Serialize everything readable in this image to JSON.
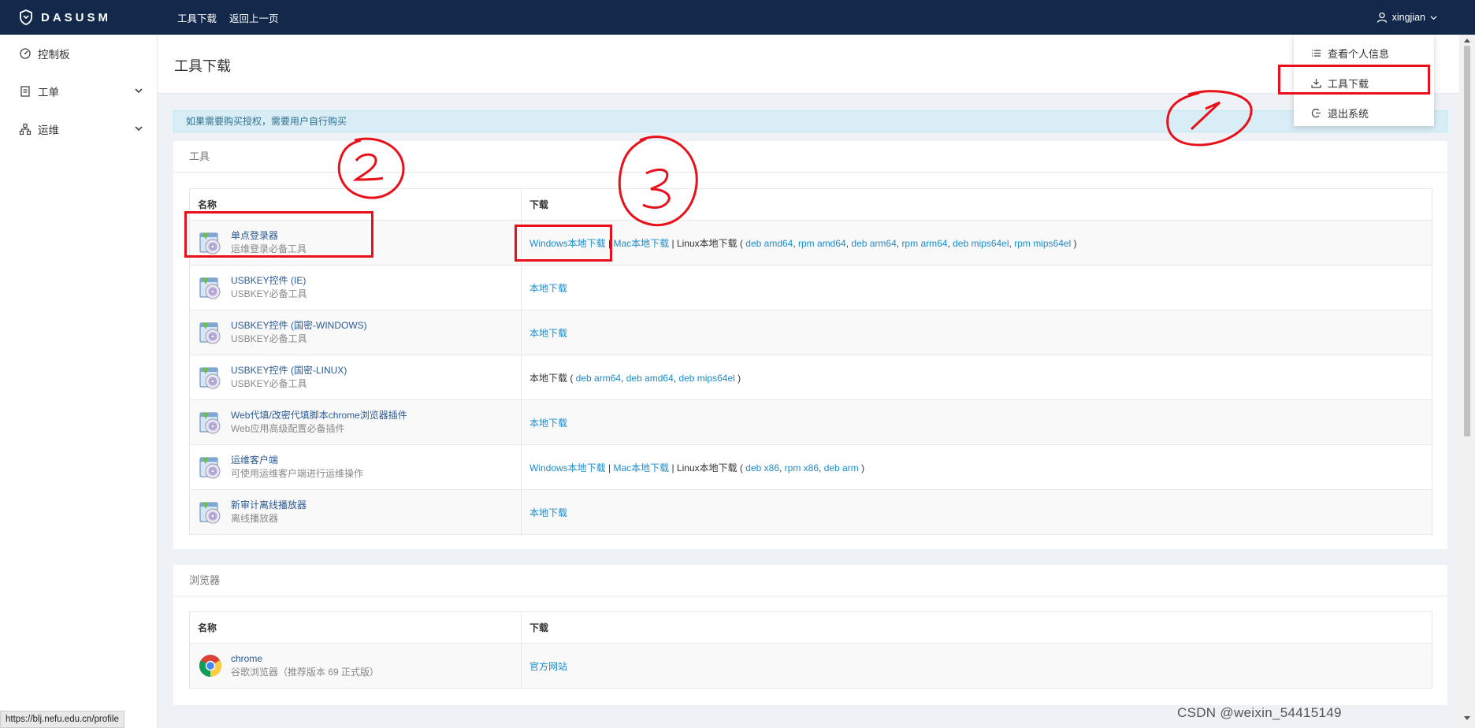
{
  "navbar": {
    "brand": "DASUSM",
    "links": [
      "工具下载",
      "返回上一页"
    ],
    "username": "xingjian"
  },
  "user_menu": {
    "items": [
      {
        "label": "查看个人信息",
        "icon": "list-icon"
      },
      {
        "label": "工具下载",
        "icon": "download-icon"
      },
      {
        "label": "退出系统",
        "icon": "logout-icon"
      }
    ]
  },
  "sidebar": {
    "items": [
      {
        "label": "控制板",
        "icon": "dashboard-icon"
      },
      {
        "label": "工单",
        "icon": "ticket-icon"
      },
      {
        "label": "运维",
        "icon": "sitemap-icon"
      }
    ]
  },
  "page": {
    "title": "工具下载",
    "notice": "如果需要购买授权，需要用户自行购买"
  },
  "tools_panel": {
    "title": "工具",
    "columns": [
      "名称",
      "下载"
    ],
    "rows": [
      {
        "name": "单点登录器",
        "desc": "运维登录必备工具",
        "download": [
          {
            "text": "Windows本地下载",
            "link": true
          },
          {
            "text": " | ",
            "link": false
          },
          {
            "text": "Mac本地下载",
            "link": true
          },
          {
            "text": " | Linux本地下载 ( ",
            "link": false
          },
          {
            "text": "deb amd64",
            "link": true
          },
          {
            "text": ", ",
            "link": false
          },
          {
            "text": "rpm amd64",
            "link": true
          },
          {
            "text": ", ",
            "link": false
          },
          {
            "text": "deb arm64",
            "link": true
          },
          {
            "text": ", ",
            "link": false
          },
          {
            "text": "rpm arm64",
            "link": true
          },
          {
            "text": ", ",
            "link": false
          },
          {
            "text": "deb mips64el",
            "link": true
          },
          {
            "text": ", ",
            "link": false
          },
          {
            "text": "rpm mips64el",
            "link": true
          },
          {
            "text": " )",
            "link": false
          }
        ]
      },
      {
        "name": "USBKEY控件 (IE)",
        "desc": "USBKEY必备工具",
        "download": [
          {
            "text": "本地下载",
            "link": true
          }
        ]
      },
      {
        "name": "USBKEY控件 (国密-WINDOWS)",
        "desc": "USBKEY必备工具",
        "download": [
          {
            "text": "本地下载",
            "link": true
          }
        ]
      },
      {
        "name": "USBKEY控件 (国密-LINUX)",
        "desc": "USBKEY必备工具",
        "download": [
          {
            "text": "本地下载 ( ",
            "link": false
          },
          {
            "text": "deb arm64",
            "link": true
          },
          {
            "text": ", ",
            "link": false
          },
          {
            "text": "deb amd64",
            "link": true
          },
          {
            "text": ", ",
            "link": false
          },
          {
            "text": "deb mips64el",
            "link": true
          },
          {
            "text": " )",
            "link": false
          }
        ]
      },
      {
        "name": "Web代填/改密代填脚本chrome浏览器插件",
        "desc": "Web应用高级配置必备插件",
        "download": [
          {
            "text": "本地下载",
            "link": true
          }
        ]
      },
      {
        "name": "运维客户端",
        "desc": "可使用运维客户端进行运维操作",
        "download": [
          {
            "text": "Windows本地下载",
            "link": true
          },
          {
            "text": " | ",
            "link": false
          },
          {
            "text": "Mac本地下载",
            "link": true
          },
          {
            "text": " | Linux本地下载 ( ",
            "link": false
          },
          {
            "text": "deb x86",
            "link": true
          },
          {
            "text": ", ",
            "link": false
          },
          {
            "text": "rpm x86",
            "link": true
          },
          {
            "text": ", ",
            "link": false
          },
          {
            "text": "deb arm",
            "link": true
          },
          {
            "text": " )",
            "link": false
          }
        ]
      },
      {
        "name": "新审计离线播放器",
        "desc": "离线播放器",
        "download": [
          {
            "text": "本地下载",
            "link": true
          }
        ]
      }
    ]
  },
  "browser_panel": {
    "title": "浏览器",
    "columns": [
      "名称",
      "下载"
    ],
    "rows": [
      {
        "name": "chrome",
        "desc": "谷歌浏览器（推荐版本 69 正式版）",
        "download": [
          {
            "text": "官方网站",
            "link": true
          }
        ]
      }
    ]
  },
  "statusbar": {
    "url": "https://blj.nefu.edu.cn/profile"
  },
  "watermark": "CSDN @weixin_54415149",
  "annotation_colors": {
    "red": "#e8101a"
  }
}
